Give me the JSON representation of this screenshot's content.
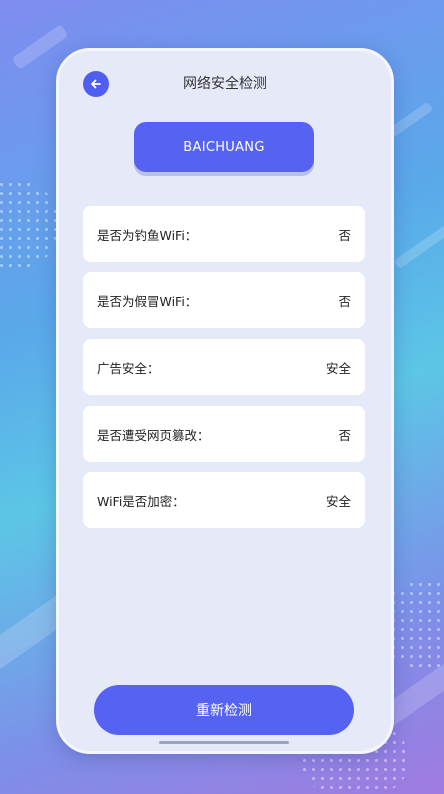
{
  "header": {
    "title": "网络安全检测",
    "back_icon": "arrow-left-icon"
  },
  "brand": {
    "label": "BAICHUANG"
  },
  "checks": [
    {
      "label": "是否为钓鱼WiFi：",
      "value": "否"
    },
    {
      "label": "是否为假冒WiFi：",
      "value": "否"
    },
    {
      "label": "广告安全：",
      "value": "安全"
    },
    {
      "label": "是否遭受网页篡改：",
      "value": "否"
    },
    {
      "label": "WiFi是否加密：",
      "value": "安全"
    }
  ],
  "actions": {
    "recheck_label": "重新检测"
  },
  "colors": {
    "accent": "#5663f2",
    "card_bg": "#e6e9f8",
    "row_bg": "#ffffff"
  }
}
